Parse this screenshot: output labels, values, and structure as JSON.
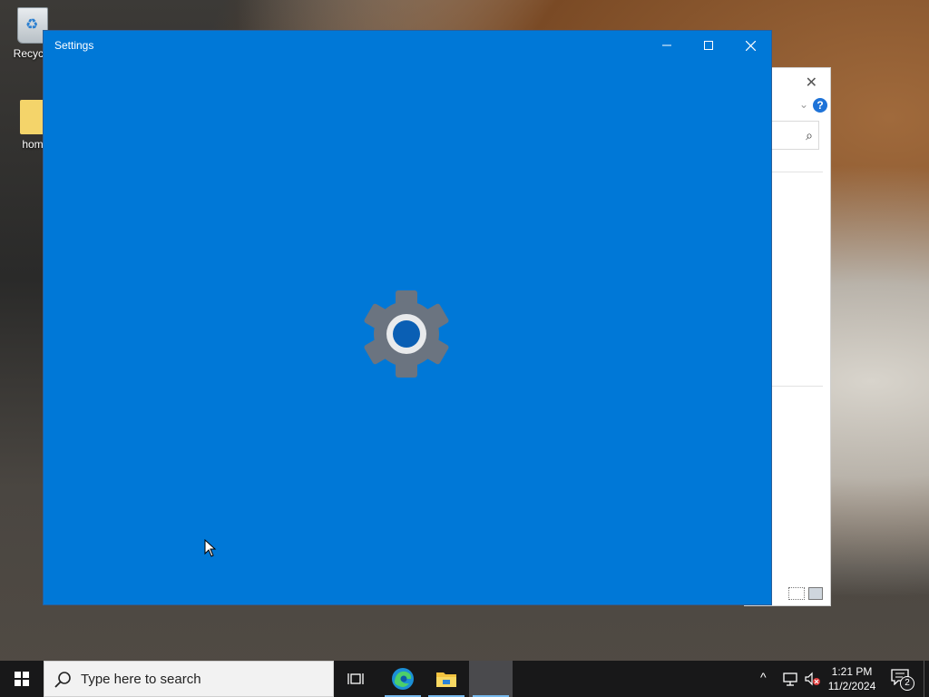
{
  "desktop": {
    "icons": [
      {
        "label": "Recycle",
        "icon": "recycle-bin-icon"
      },
      {
        "label": "hom",
        "icon": "folder-icon"
      }
    ]
  },
  "background_window": {
    "close_glyph": "✕",
    "help_glyph": "?"
  },
  "settings_window": {
    "title": "Settings",
    "accent_color": "#0078d7",
    "splash_icon": "gear-icon"
  },
  "taskbar": {
    "search_placeholder": "Type here to search",
    "apps": [
      {
        "name": "Task View",
        "icon": "task-view-icon"
      },
      {
        "name": "Microsoft Edge",
        "icon": "edge-icon"
      },
      {
        "name": "File Explorer",
        "icon": "folder-icon"
      },
      {
        "name": "Settings",
        "icon": "settings-app-icon",
        "active": true
      }
    ],
    "tray": {
      "chevron": "^",
      "time": "1:21 PM",
      "date": "11/2/2024",
      "notification_count": "2"
    }
  }
}
